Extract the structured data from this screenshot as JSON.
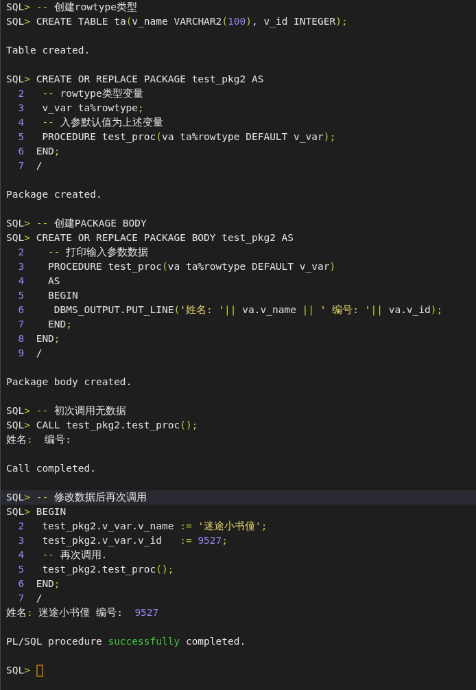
{
  "terminal": {
    "lines": [
      {
        "kind": "text",
        "highlighted": false,
        "segments": [
          {
            "text": "SQL",
            "kind": "plain"
          },
          {
            "text": ">",
            "kind": "symbol"
          },
          {
            "text": " --",
            "kind": "symbol"
          },
          {
            "text": " 创建rowtype类型",
            "kind": "plain"
          }
        ]
      },
      {
        "kind": "text",
        "highlighted": false,
        "segments": [
          {
            "text": "SQL",
            "kind": "plain"
          },
          {
            "text": ">",
            "kind": "symbol"
          },
          {
            "text": " CREATE TABLE ta",
            "kind": "plain"
          },
          {
            "text": "(",
            "kind": "symbol"
          },
          {
            "text": "v_name VARCHAR2",
            "kind": "plain"
          },
          {
            "text": "(",
            "kind": "symbol"
          },
          {
            "text": "100",
            "kind": "number"
          },
          {
            "text": ")",
            "kind": "symbol"
          },
          {
            "text": ", v_id INTEGER",
            "kind": "plain"
          },
          {
            "text": ");",
            "kind": "symbol"
          }
        ]
      },
      {
        "kind": "blank"
      },
      {
        "kind": "text",
        "highlighted": false,
        "segments": [
          {
            "text": "Table created.",
            "kind": "plain"
          }
        ]
      },
      {
        "kind": "blank"
      },
      {
        "kind": "text",
        "highlighted": false,
        "segments": [
          {
            "text": "SQL",
            "kind": "plain"
          },
          {
            "text": ">",
            "kind": "symbol"
          },
          {
            "text": " CREATE OR REPLACE PACKAGE test_pkg2 AS",
            "kind": "plain"
          }
        ]
      },
      {
        "kind": "text",
        "highlighted": false,
        "segments": [
          {
            "text": "  2",
            "kind": "lineno"
          },
          {
            "text": "   --",
            "kind": "symbol"
          },
          {
            "text": " rowtype类型变量",
            "kind": "plain"
          }
        ]
      },
      {
        "kind": "text",
        "highlighted": false,
        "segments": [
          {
            "text": "  3",
            "kind": "lineno"
          },
          {
            "text": "   v_var ta%rowtype",
            "kind": "plain"
          },
          {
            "text": ";",
            "kind": "symbol"
          }
        ]
      },
      {
        "kind": "text",
        "highlighted": false,
        "segments": [
          {
            "text": "  4",
            "kind": "lineno"
          },
          {
            "text": "   --",
            "kind": "symbol"
          },
          {
            "text": " 入参默认值为上述变量",
            "kind": "plain"
          }
        ]
      },
      {
        "kind": "text",
        "highlighted": false,
        "segments": [
          {
            "text": "  5",
            "kind": "lineno"
          },
          {
            "text": "   PROCEDURE test_proc",
            "kind": "plain"
          },
          {
            "text": "(",
            "kind": "symbol"
          },
          {
            "text": "va ta%rowtype DEFAULT v_var",
            "kind": "plain"
          },
          {
            "text": ");",
            "kind": "symbol"
          }
        ]
      },
      {
        "kind": "text",
        "highlighted": false,
        "segments": [
          {
            "text": "  6",
            "kind": "lineno"
          },
          {
            "text": "  END",
            "kind": "plain"
          },
          {
            "text": ";",
            "kind": "symbol"
          }
        ]
      },
      {
        "kind": "text",
        "highlighted": false,
        "segments": [
          {
            "text": "  7",
            "kind": "lineno"
          },
          {
            "text": "  /",
            "kind": "plain"
          }
        ]
      },
      {
        "kind": "blank"
      },
      {
        "kind": "text",
        "highlighted": false,
        "segments": [
          {
            "text": "Package created.",
            "kind": "plain"
          }
        ]
      },
      {
        "kind": "blank"
      },
      {
        "kind": "text",
        "highlighted": false,
        "segments": [
          {
            "text": "SQL",
            "kind": "plain"
          },
          {
            "text": ">",
            "kind": "symbol"
          },
          {
            "text": " --",
            "kind": "symbol"
          },
          {
            "text": " 创建PACKAGE BODY",
            "kind": "plain"
          }
        ]
      },
      {
        "kind": "text",
        "highlighted": false,
        "segments": [
          {
            "text": "SQL",
            "kind": "plain"
          },
          {
            "text": ">",
            "kind": "symbol"
          },
          {
            "text": " CREATE OR REPLACE PACKAGE BODY test_pkg2 AS",
            "kind": "plain"
          }
        ]
      },
      {
        "kind": "text",
        "highlighted": false,
        "segments": [
          {
            "text": "  2",
            "kind": "lineno"
          },
          {
            "text": "    --",
            "kind": "symbol"
          },
          {
            "text": " 打印输入参数数据",
            "kind": "plain"
          }
        ]
      },
      {
        "kind": "text",
        "highlighted": false,
        "segments": [
          {
            "text": "  3",
            "kind": "lineno"
          },
          {
            "text": "    PROCEDURE test_proc",
            "kind": "plain"
          },
          {
            "text": "(",
            "kind": "symbol"
          },
          {
            "text": "va ta%rowtype DEFAULT v_var",
            "kind": "plain"
          },
          {
            "text": ")",
            "kind": "symbol"
          }
        ]
      },
      {
        "kind": "text",
        "highlighted": false,
        "segments": [
          {
            "text": "  4",
            "kind": "lineno"
          },
          {
            "text": "    AS",
            "kind": "plain"
          }
        ]
      },
      {
        "kind": "text",
        "highlighted": false,
        "segments": [
          {
            "text": "  5",
            "kind": "lineno"
          },
          {
            "text": "    BEGIN",
            "kind": "plain"
          }
        ]
      },
      {
        "kind": "text",
        "highlighted": false,
        "segments": [
          {
            "text": "  6",
            "kind": "lineno"
          },
          {
            "text": "     DBMS_OUTPUT.PUT_LINE",
            "kind": "plain"
          },
          {
            "text": "(",
            "kind": "symbol"
          },
          {
            "text": "'姓名: '",
            "kind": "string"
          },
          {
            "text": "||",
            "kind": "symbol"
          },
          {
            "text": " va.v_name ",
            "kind": "plain"
          },
          {
            "text": "||",
            "kind": "symbol"
          },
          {
            "text": " ' 编号: '",
            "kind": "string"
          },
          {
            "text": "||",
            "kind": "symbol"
          },
          {
            "text": " va.v_id",
            "kind": "plain"
          },
          {
            "text": ");",
            "kind": "symbol"
          }
        ]
      },
      {
        "kind": "text",
        "highlighted": false,
        "segments": [
          {
            "text": "  7",
            "kind": "lineno"
          },
          {
            "text": "    END",
            "kind": "plain"
          },
          {
            "text": ";",
            "kind": "symbol"
          }
        ]
      },
      {
        "kind": "text",
        "highlighted": false,
        "segments": [
          {
            "text": "  8",
            "kind": "lineno"
          },
          {
            "text": "  END",
            "kind": "plain"
          },
          {
            "text": ";",
            "kind": "symbol"
          }
        ]
      },
      {
        "kind": "text",
        "highlighted": false,
        "segments": [
          {
            "text": "  9",
            "kind": "lineno"
          },
          {
            "text": "  /",
            "kind": "plain"
          }
        ]
      },
      {
        "kind": "blank"
      },
      {
        "kind": "text",
        "highlighted": false,
        "segments": [
          {
            "text": "Package body created.",
            "kind": "plain"
          }
        ]
      },
      {
        "kind": "blank"
      },
      {
        "kind": "text",
        "highlighted": false,
        "segments": [
          {
            "text": "SQL",
            "kind": "plain"
          },
          {
            "text": ">",
            "kind": "symbol"
          },
          {
            "text": " --",
            "kind": "symbol"
          },
          {
            "text": " 初次调用无数据",
            "kind": "plain"
          }
        ]
      },
      {
        "kind": "text",
        "highlighted": false,
        "segments": [
          {
            "text": "SQL",
            "kind": "plain"
          },
          {
            "text": ">",
            "kind": "symbol"
          },
          {
            "text": " CALL test_pkg2.test_proc",
            "kind": "plain"
          },
          {
            "text": "();",
            "kind": "symbol"
          }
        ]
      },
      {
        "kind": "text",
        "highlighted": false,
        "segments": [
          {
            "text": "姓名",
            "kind": "plain"
          },
          {
            "text": ":",
            "kind": "symbol"
          },
          {
            "text": "  编号:",
            "kind": "plain"
          }
        ]
      },
      {
        "kind": "blank"
      },
      {
        "kind": "text",
        "highlighted": false,
        "segments": [
          {
            "text": "Call completed.",
            "kind": "plain"
          }
        ]
      },
      {
        "kind": "blank"
      },
      {
        "kind": "text",
        "highlighted": true,
        "segments": [
          {
            "text": "SQL",
            "kind": "plain"
          },
          {
            "text": ">",
            "kind": "symbol"
          },
          {
            "text": " --",
            "kind": "symbol"
          },
          {
            "text": " 修改数据后再次调用",
            "kind": "plain"
          }
        ]
      },
      {
        "kind": "text",
        "highlighted": false,
        "segments": [
          {
            "text": "SQL",
            "kind": "plain"
          },
          {
            "text": ">",
            "kind": "symbol"
          },
          {
            "text": " BEGIN",
            "kind": "plain"
          }
        ]
      },
      {
        "kind": "text",
        "highlighted": false,
        "segments": [
          {
            "text": "  2",
            "kind": "lineno"
          },
          {
            "text": "   test_pkg2.v_var.v_name ",
            "kind": "plain"
          },
          {
            "text": ":=",
            "kind": "symbol"
          },
          {
            "text": " '迷途小书僮'",
            "kind": "string"
          },
          {
            "text": ";",
            "kind": "symbol"
          }
        ]
      },
      {
        "kind": "text",
        "highlighted": false,
        "segments": [
          {
            "text": "  3",
            "kind": "lineno"
          },
          {
            "text": "   test_pkg2.v_var.v_id   ",
            "kind": "plain"
          },
          {
            "text": ":=",
            "kind": "symbol"
          },
          {
            "text": " 9527",
            "kind": "number"
          },
          {
            "text": ";",
            "kind": "symbol"
          }
        ]
      },
      {
        "kind": "text",
        "highlighted": false,
        "segments": [
          {
            "text": "  4",
            "kind": "lineno"
          },
          {
            "text": "   --",
            "kind": "symbol"
          },
          {
            "text": " 再次调用.",
            "kind": "plain"
          }
        ]
      },
      {
        "kind": "text",
        "highlighted": false,
        "segments": [
          {
            "text": "  5",
            "kind": "lineno"
          },
          {
            "text": "   test_pkg2.test_proc",
            "kind": "plain"
          },
          {
            "text": "();",
            "kind": "symbol"
          }
        ]
      },
      {
        "kind": "text",
        "highlighted": false,
        "segments": [
          {
            "text": "  6",
            "kind": "lineno"
          },
          {
            "text": "  END",
            "kind": "plain"
          },
          {
            "text": ";",
            "kind": "symbol"
          }
        ]
      },
      {
        "kind": "text",
        "highlighted": false,
        "segments": [
          {
            "text": "  7",
            "kind": "lineno"
          },
          {
            "text": "  /",
            "kind": "plain"
          }
        ]
      },
      {
        "kind": "text",
        "highlighted": false,
        "segments": [
          {
            "text": "姓名",
            "kind": "plain"
          },
          {
            "text": ":",
            "kind": "symbol"
          },
          {
            "text": " 迷途小书僮 编号:  ",
            "kind": "plain"
          },
          {
            "text": "9527",
            "kind": "number"
          }
        ]
      },
      {
        "kind": "blank"
      },
      {
        "kind": "text",
        "highlighted": false,
        "segments": [
          {
            "text": "PL/SQL procedure ",
            "kind": "plain"
          },
          {
            "text": "successfully",
            "kind": "success"
          },
          {
            "text": " completed.",
            "kind": "plain"
          }
        ]
      },
      {
        "kind": "blank"
      },
      {
        "kind": "input",
        "highlighted": false,
        "segments": [
          {
            "text": "SQL",
            "kind": "plain"
          },
          {
            "text": ">",
            "kind": "symbol"
          }
        ]
      }
    ]
  }
}
